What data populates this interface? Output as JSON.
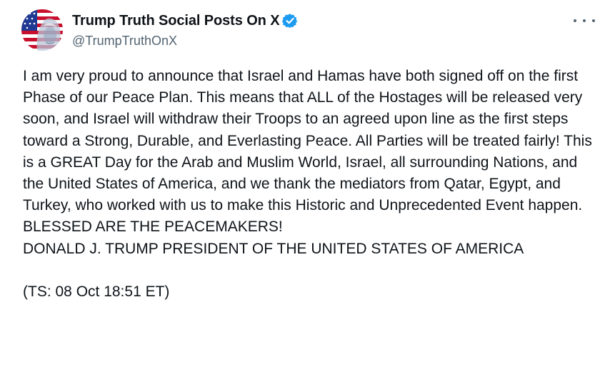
{
  "author": {
    "display_name": "Trump Truth Social Posts On X",
    "handle": "@TrumpTruthOnX",
    "verified": true,
    "avatar_icon": "flag-portrait-avatar",
    "verified_icon": "verified-badge-icon",
    "verified_color": "#1d9bf0"
  },
  "menu": {
    "icon": "more-options-icon"
  },
  "post": {
    "text": "I am very proud to announce that Israel and Hamas have both signed off on the first Phase of our Peace Plan. This means that ALL of the Hostages will be released very soon, and Israel will withdraw their Troops to an agreed upon line as the first steps toward a Strong, Durable, and Everlasting Peace. All Parties will be treated fairly! This is a GREAT Day for the Arab and Muslim World, Israel, all surrounding Nations, and the United States of America, and we thank the mediators from Qatar, Egypt, and Turkey, who worked with us to make this Historic and Unprecedented Event happen. BLESSED ARE THE PEACEMAKERS!\nDONALD J. TRUMP PRESIDENT OF THE UNITED STATES OF AMERICA\n\n(TS: 08 Oct 18:51 ET)"
  },
  "colors": {
    "text": "#0f1419",
    "secondary": "#536471",
    "background": "#ffffff"
  }
}
